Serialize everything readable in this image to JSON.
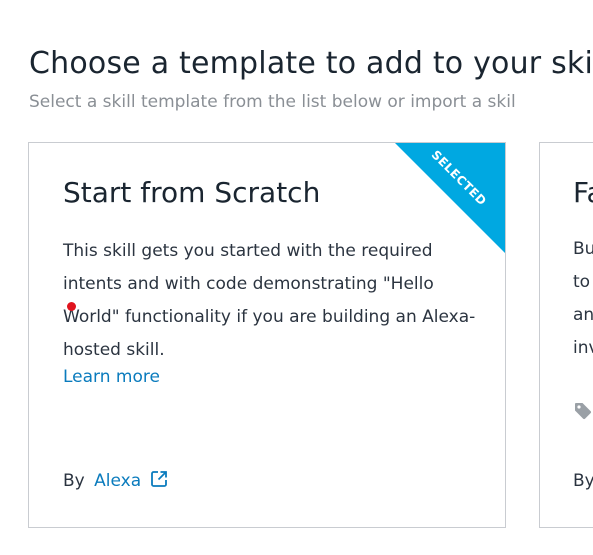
{
  "header": {
    "title": "Choose a template to add to your skill",
    "subtitle": "Select a skill template from the list below or import a skil"
  },
  "cards": [
    {
      "badge": "SELECTED",
      "title": "Start from Scratch",
      "description": "This skill gets you started with the required intents and with code demonstrating \"Hello World\" functionality if you are building an Alexa-hosted skill.",
      "learn_more": "Learn more",
      "by_label": "By",
      "author": "Alexa"
    },
    {
      "title": "Fa",
      "description_lines": [
        "Bu",
        "to",
        "an",
        "inv"
      ],
      "by_label": "By"
    }
  ],
  "colors": {
    "accent": "#00a8e1",
    "link": "#0a7bbd",
    "border": "#c9ccd1"
  }
}
